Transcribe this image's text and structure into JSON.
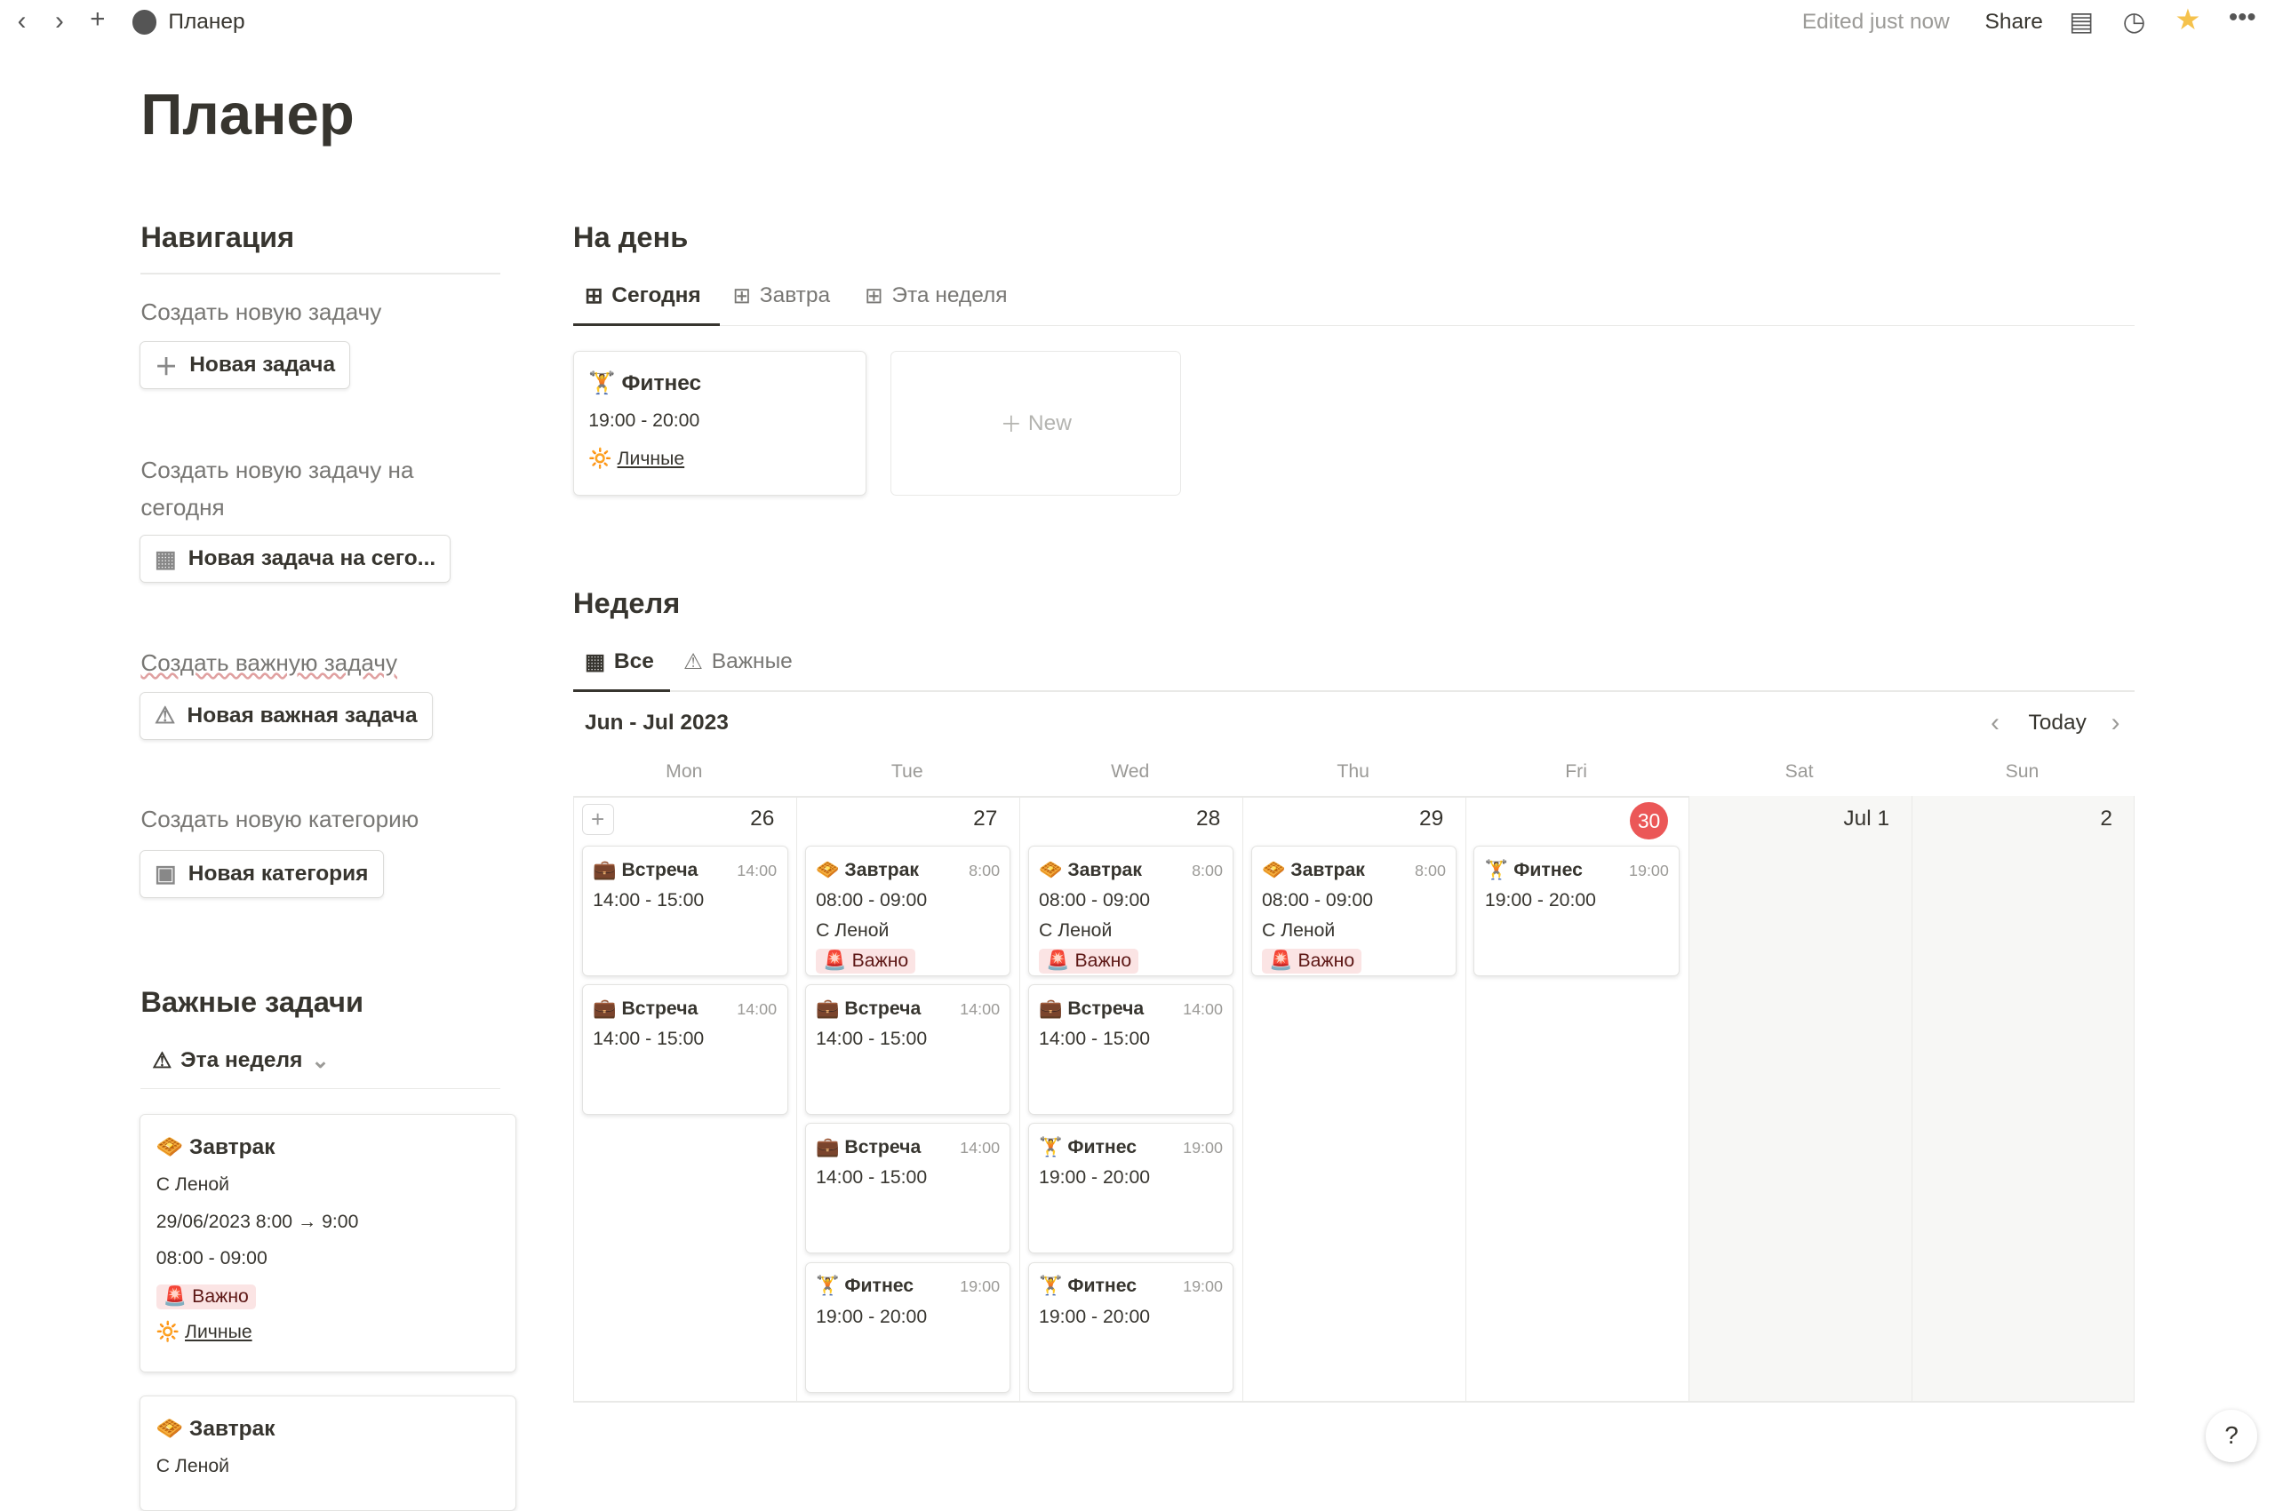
{
  "topbar": {
    "title": "Планер",
    "edited": "Edited just now",
    "share": "Share"
  },
  "page_title": "Планер",
  "nav": {
    "heading": "Навигация",
    "items": [
      {
        "label": "Создать новую задачу",
        "button": "Новая задача",
        "icon": "plus-icon"
      },
      {
        "label": "Создать новую задачу на сегодня",
        "button": "Новая задача на сего...",
        "icon": "calendar-icon"
      },
      {
        "label": "Создать важную задачу",
        "button": "Новая важная задача",
        "icon": "warning-icon"
      },
      {
        "label": "Создать новую категорию",
        "button": "Новая категория",
        "icon": "folder-plus-icon"
      }
    ]
  },
  "important": {
    "heading": "Важные задачи",
    "view": "Эта неделя",
    "cards": [
      {
        "title": "Завтрак",
        "note": "С Леной",
        "date": "29/06/2023 8:00 → 9:00",
        "time": "08:00 - 09:00",
        "tag": "Важно",
        "category": "Личные"
      },
      {
        "title": "Завтрак",
        "note": "С Леной"
      }
    ]
  },
  "day": {
    "heading": "На день",
    "tabs": [
      "Сегодня",
      "Завтра",
      "Эта неделя"
    ],
    "active_tab": 0,
    "card": {
      "title": "Фитнес",
      "time": "19:00 - 20:00",
      "category": "Личные"
    },
    "new_label": "New"
  },
  "week": {
    "heading": "Неделя",
    "tabs": [
      "Все",
      "Важные"
    ],
    "active_tab": 0,
    "range": "Jun - Jul 2023",
    "today": "Today",
    "dows": [
      "Mon",
      "Tue",
      "Wed",
      "Thu",
      "Fri",
      "Sat",
      "Sun"
    ],
    "days": [
      {
        "num": "26",
        "events": [
          {
            "e": "💼",
            "title": "Встреча",
            "tm": "14:00",
            "time": "14:00 - 15:00"
          },
          {
            "e": "💼",
            "title": "Встреча",
            "tm": "14:00",
            "time": "14:00 - 15:00"
          }
        ]
      },
      {
        "num": "27",
        "events": [
          {
            "e": "🧇",
            "title": "Завтрак",
            "tm": "8:00",
            "time": "08:00 - 09:00",
            "note": "С Леной",
            "tag": "Важно"
          },
          {
            "e": "💼",
            "title": "Встреча",
            "tm": "14:00",
            "time": "14:00 - 15:00"
          },
          {
            "e": "💼",
            "title": "Встреча",
            "tm": "14:00",
            "time": "14:00 - 15:00"
          },
          {
            "e": "🏋",
            "title": "Фитнес",
            "tm": "19:00",
            "time": "19:00 - 20:00"
          }
        ]
      },
      {
        "num": "28",
        "events": [
          {
            "e": "🧇",
            "title": "Завтрак",
            "tm": "8:00",
            "time": "08:00 - 09:00",
            "note": "С Леной",
            "tag": "Важно"
          },
          {
            "e": "💼",
            "title": "Встреча",
            "tm": "14:00",
            "time": "14:00 - 15:00"
          },
          {
            "e": "🏋",
            "title": "Фитнес",
            "tm": "19:00",
            "time": "19:00 - 20:00"
          },
          {
            "e": "🏋",
            "title": "Фитнес",
            "tm": "19:00",
            "time": "19:00 - 20:00"
          }
        ]
      },
      {
        "num": "29",
        "events": [
          {
            "e": "🧇",
            "title": "Завтрак",
            "tm": "8:00",
            "time": "08:00 - 09:00",
            "note": "С Леной",
            "tag": "Важно"
          }
        ]
      },
      {
        "num": "30",
        "today": true,
        "events": [
          {
            "e": "🏋",
            "title": "Фитнес",
            "tm": "19:00",
            "time": "19:00 - 20:00"
          }
        ]
      },
      {
        "num": "Jul 1",
        "events": []
      },
      {
        "num": "2",
        "events": []
      }
    ]
  },
  "colors": {
    "today": "#eb5757",
    "tag_bg": "#fbe4e4",
    "star": "#f5c24c"
  },
  "help": "?"
}
